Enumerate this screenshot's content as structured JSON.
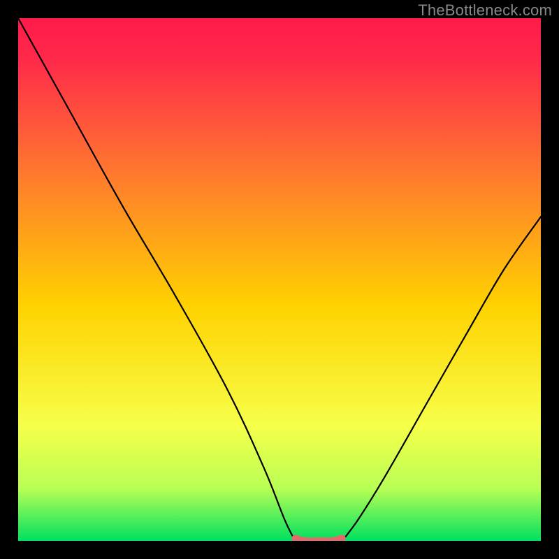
{
  "watermark": "TheBottleneck.com",
  "colors": {
    "frame": "#000000",
    "gradient_top": "#ff1a4a",
    "gradient_mid": "#ffd200",
    "gradient_bottom": "#00e060",
    "curve": "#000000",
    "highlight": "#e06c6c"
  },
  "chart_data": {
    "type": "line",
    "title": "",
    "xlabel": "",
    "ylabel": "",
    "xlim": [
      0,
      100
    ],
    "ylim": [
      0,
      100
    ],
    "series": [
      {
        "name": "left-branch",
        "x": [
          0,
          10,
          20,
          30,
          40,
          47,
          51,
          53
        ],
        "values": [
          100,
          82,
          64,
          47,
          29,
          14,
          4,
          0
        ]
      },
      {
        "name": "right-branch",
        "x": [
          62,
          65,
          70,
          78,
          86,
          93,
          100
        ],
        "values": [
          0,
          4,
          12,
          26,
          40,
          52,
          62
        ]
      },
      {
        "name": "bottom-highlight",
        "x": [
          53,
          55,
          58,
          60,
          62
        ],
        "values": [
          0.5,
          0,
          0,
          0,
          0.5
        ]
      }
    ],
    "annotations": []
  }
}
